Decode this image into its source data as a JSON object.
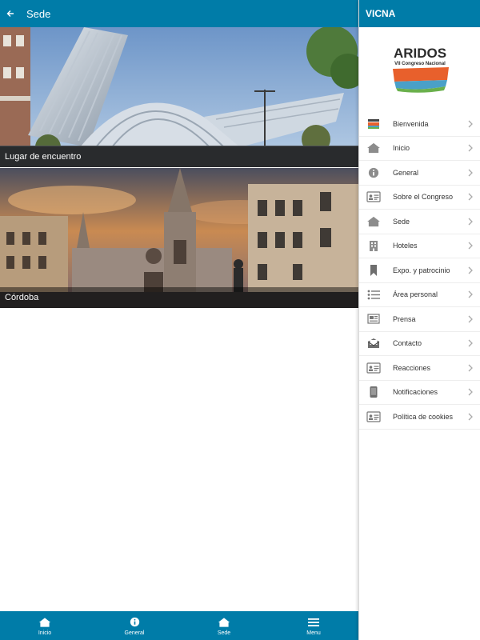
{
  "header": {
    "title": "Sede"
  },
  "cards": [
    {
      "caption": "Lugar de encuentro"
    },
    {
      "caption": "Córdoba"
    }
  ],
  "tabs": [
    {
      "label": "Inicio",
      "icon": "home-icon"
    },
    {
      "label": "General",
      "icon": "info-icon"
    },
    {
      "label": "Sede",
      "icon": "home-icon"
    },
    {
      "label": "Menu",
      "icon": "menu-icon"
    }
  ],
  "drawer": {
    "title": "VICNA",
    "logo": {
      "brand": "ARIDOS",
      "subtitle": "VII Congreso Nacional"
    },
    "items": [
      {
        "label": "Bienvenida",
        "icon": "aridos-logo-icon"
      },
      {
        "label": "Inicio",
        "icon": "home-icon"
      },
      {
        "label": "General",
        "icon": "info-icon"
      },
      {
        "label": "Sobre el Congreso",
        "icon": "id-card-icon"
      },
      {
        "label": "Sede",
        "icon": "home-icon"
      },
      {
        "label": "Hoteles",
        "icon": "building-icon"
      },
      {
        "label": "Expo. y patrocinio",
        "icon": "bookmark-icon"
      },
      {
        "label": "Área personal",
        "icon": "list-icon"
      },
      {
        "label": "Prensa",
        "icon": "newspaper-icon"
      },
      {
        "label": "Contacto",
        "icon": "envelope-icon"
      },
      {
        "label": "Reacciones",
        "icon": "id-card-icon"
      },
      {
        "label": "Notificaciones",
        "icon": "phone-icon"
      },
      {
        "label": "Política de cookies",
        "icon": "id-card-icon"
      }
    ]
  },
  "colors": {
    "primary": "#007ca8",
    "drawer_text": "#333333",
    "icon_gray": "#8c8c8c"
  }
}
